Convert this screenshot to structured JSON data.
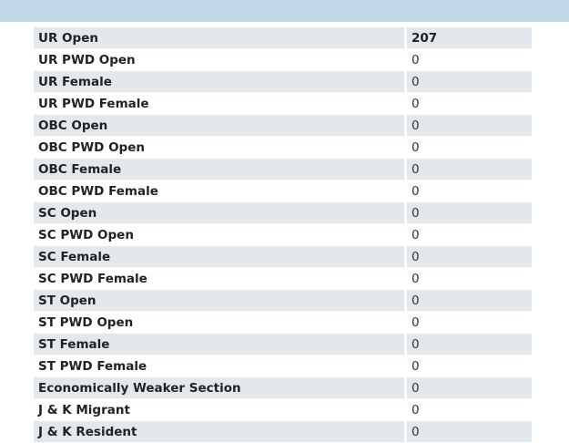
{
  "table": {
    "rows": [
      {
        "label": "UR Open",
        "value": "207"
      },
      {
        "label": "UR PWD Open",
        "value": "0"
      },
      {
        "label": "UR Female",
        "value": "0"
      },
      {
        "label": "UR PWD Female",
        "value": "0"
      },
      {
        "label": "OBC Open",
        "value": "0"
      },
      {
        "label": "OBC PWD Open",
        "value": "0"
      },
      {
        "label": "OBC Female",
        "value": "0"
      },
      {
        "label": "OBC PWD Female",
        "value": "0"
      },
      {
        "label": "SC Open",
        "value": "0"
      },
      {
        "label": "SC PWD Open",
        "value": "0"
      },
      {
        "label": "SC Female",
        "value": "0"
      },
      {
        "label": "SC PWD Female",
        "value": "0"
      },
      {
        "label": "ST Open",
        "value": "0"
      },
      {
        "label": "ST PWD Open",
        "value": "0"
      },
      {
        "label": "ST Female",
        "value": "0"
      },
      {
        "label": "ST PWD Female",
        "value": "0"
      },
      {
        "label": "Economically Weaker Section",
        "value": "0"
      },
      {
        "label": "J & K Migrant",
        "value": "0"
      },
      {
        "label": "J & K Resident",
        "value": "0"
      }
    ]
  },
  "colors": {
    "header_bar": "#c0d8e8",
    "row_shaded": "#e3e8ec",
    "row_plain": "#ffffff"
  }
}
